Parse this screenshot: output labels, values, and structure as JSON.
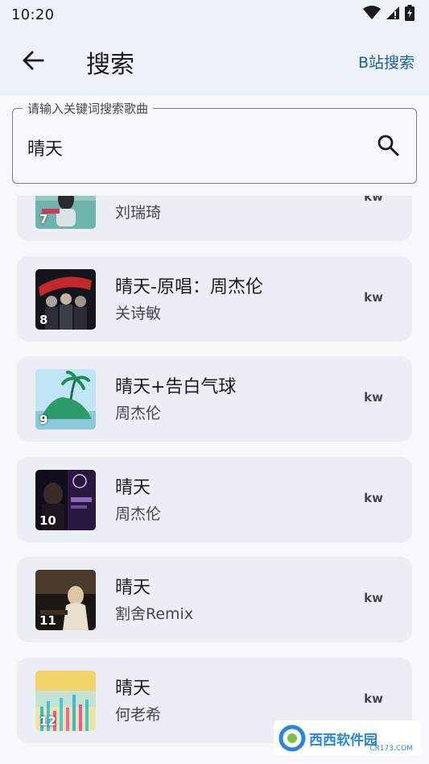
{
  "status_bar": {
    "time": "10:20",
    "icons": [
      "wifi-icon",
      "cellular-signal-icon",
      "battery-charging-icon"
    ]
  },
  "app_bar": {
    "back_icon": "arrow-back-icon",
    "title": "搜索",
    "action_label": "B站搜索"
  },
  "search": {
    "label": "请输入关键词搜索歌曲",
    "value": "晴天",
    "icon": "search-icon"
  },
  "results": [
    {
      "index": "7",
      "title": "晴天",
      "artist": "刘瑞琦",
      "source": "kw"
    },
    {
      "index": "8",
      "title": "晴天-原唱：周杰伦",
      "artist": "关诗敏",
      "source": "kw"
    },
    {
      "index": "9",
      "title": "晴天+告白气球",
      "artist": "周杰伦",
      "source": "kw"
    },
    {
      "index": "10",
      "title": "晴天",
      "artist": "周杰伦",
      "source": "kw"
    },
    {
      "index": "11",
      "title": "晴天",
      "artist": "割舍Remix",
      "source": "kw"
    },
    {
      "index": "12",
      "title": "晴天",
      "artist": "何老希",
      "source": "kw"
    }
  ],
  "watermark": {
    "name": "西西软件园",
    "sub": "CR173.COM"
  },
  "colors": {
    "accent": "#1f5d9b",
    "card": "#eceef5",
    "app_bar": "#edf1f8"
  }
}
